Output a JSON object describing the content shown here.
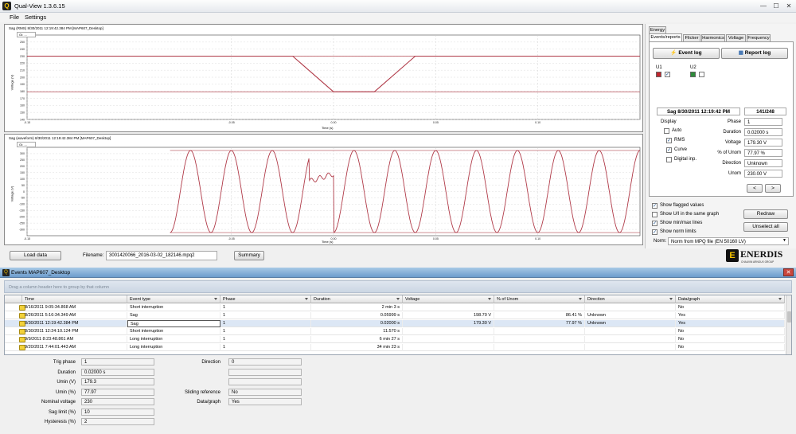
{
  "app": {
    "title": "Qual-View 1.3.6.15"
  },
  "menu": {
    "file": "File",
    "settings": "Settings"
  },
  "rms_chart": {
    "title": "Sag  (RMS)   8/30/2011  12:19:42.384  PM     [MAP607_Desktop]",
    "selector": "Gr. ...",
    "ylabel": "Voltage (V)",
    "xlabel": "Time (s)"
  },
  "wave_chart": {
    "title": "Sag  (waveform)   8/30/2011  12:19:42.384  PM     [MAP607_Desktop]",
    "selector": "Gr. ...",
    "ylabel": "Voltage (V)",
    "xlabel": "Time (s)"
  },
  "chart_data": [
    {
      "type": "line",
      "title": "Sag  (RMS)   8/30/2011  12:19:42.384  PM     [MAP607_Desktop]",
      "xlabel": "Time (s)",
      "ylabel": "Voltage (V)",
      "xlim": [
        -0.15,
        0.15
      ],
      "ylim": [
        140,
        260
      ],
      "x_ticks": [
        "-0.15",
        "-0.05",
        "0.00",
        "0.05",
        "0.10"
      ],
      "y_ticks": [
        "250",
        "240",
        "230",
        "220",
        "210",
        "200",
        "190",
        "180",
        "170",
        "160",
        "150",
        "140"
      ],
      "series": [
        {
          "x": [
            -0.15,
            -0.02,
            0.0,
            0.02,
            0.04,
            0.15
          ],
          "values": [
            230,
            230,
            179.3,
            179.3,
            230,
            230
          ]
        }
      ],
      "limit_lines": [
        230,
        179.3
      ]
    },
    {
      "type": "line",
      "title": "Sag  (waveform)   8/30/2011  12:19:42.384  PM     [MAP607_Desktop]",
      "xlabel": "Time (s)",
      "ylabel": "Voltage (V)",
      "xlim": [
        -0.15,
        0.15
      ],
      "ylim": [
        -350,
        350
      ],
      "x_ticks": [
        "-0.15",
        "-0.05",
        "0.00",
        "0.05",
        "0.10"
      ],
      "y_ticks": [
        "300",
        "250",
        "200",
        "150",
        "100",
        "50",
        "0",
        "-50",
        "-100",
        "-150",
        "-200",
        "-250",
        "-300"
      ],
      "frequency_hz": 50,
      "amplitude": 325,
      "x_start": -0.08,
      "limit_lines": [
        325,
        -325
      ]
    }
  ],
  "toolbar_bottom": {
    "load_data": "Load data",
    "filename_label": "Filename:",
    "filename": "3001420066_2016-03-02_182146.mpq2",
    "summary": "Summary"
  },
  "right_panel": {
    "tabs_row1": [
      "Energy"
    ],
    "tabs_row2": [
      "Events/reports",
      "Flicker",
      "Harmonics",
      "Voltage",
      "Frequency"
    ],
    "event_log": "Event log",
    "report_log": "Report log",
    "u1": "U1",
    "u2": "U2",
    "event_header": "Sag 8/30/2011 12:19:42 PM",
    "event_count": "141/248",
    "display_label": "Display",
    "display_options": [
      "Auto",
      "RMS",
      "Curve",
      "Digital inp."
    ],
    "fields": [
      {
        "label": "Phase",
        "value": "1"
      },
      {
        "label": "Duration",
        "value": "0.02000 s"
      },
      {
        "label": "Voltage",
        "value": "179.30 V"
      },
      {
        "label": "% of Unom",
        "value": "77.97 %"
      },
      {
        "label": "Direction",
        "value": "Unknown"
      },
      {
        "label": "Unom",
        "value": "230.00 V"
      }
    ],
    "prev": "<",
    "next": ">",
    "options": [
      "Show flagged values",
      "Show U/I in the same graph",
      "Show min/max lines",
      "Show norm limits"
    ],
    "redraw": "Redraw",
    "unselect_all": "Unselect all",
    "norm_label": "Norm:",
    "norm_value": "Norm from MPQ file (EN 50160 LV)",
    "brand": "ENERDIS",
    "brand_sub": "CHAUVIN ARNOUX GROUP"
  },
  "events_window": {
    "title": "Events MAP607_Desktop",
    "group_hint": "Drag a column header here to group by that column",
    "columns": [
      "Time",
      "Event type",
      "Phase",
      "Duration",
      "Voltage",
      "% of Unom",
      "Direction",
      "Data/graph"
    ],
    "rows": [
      [
        "8/16/2011 9:05:34.868 AM",
        "Short interruption",
        "1",
        "2 min 3 s",
        "",
        "",
        "",
        "No"
      ],
      [
        "8/26/2011 5:16:34.349 AM",
        "Sag",
        "1",
        "0.05999 s",
        "198.70 V",
        "86.41 %",
        "Unknown",
        "Yes"
      ],
      [
        "8/30/2011 12:19:42.384 PM",
        "Sag",
        "1",
        "0.02000 s",
        "179.30 V",
        "77.97 %",
        "Unknown",
        "Yes"
      ],
      [
        "8/30/2011 12:24:10.124 PM",
        "Short interruption",
        "1",
        "11.570 s",
        "",
        "",
        "",
        "No"
      ],
      [
        "9/9/2011 8:23:48.861 AM",
        "Long interruption",
        "1",
        "6 min 27 s",
        "",
        "",
        "",
        "No"
      ],
      [
        "9/20/2011 7:44:01.443 AM",
        "Long interruption",
        "1",
        "34 min 23 s",
        "",
        "",
        "",
        "No"
      ]
    ],
    "detail_left": [
      {
        "label": "Trig phase",
        "value": "1"
      },
      {
        "label": "Duration",
        "value": "0.02000 s"
      },
      {
        "label": "Umin (V)",
        "value": "179.3"
      },
      {
        "label": "Umin (%)",
        "value": "77.97"
      },
      {
        "label": "Nominal voltage",
        "value": "230"
      },
      {
        "label": "Sag limit (%)",
        "value": "10"
      },
      {
        "label": "Hysteresis (%)",
        "value": "2"
      }
    ],
    "detail_right": [
      {
        "label": "Direction",
        "value": "0"
      },
      {
        "label": "",
        "value": ""
      },
      {
        "label": "",
        "value": ""
      },
      {
        "label": "Sliding reference",
        "value": "No"
      },
      {
        "label": "Data/graph",
        "value": "Yes"
      }
    ]
  }
}
